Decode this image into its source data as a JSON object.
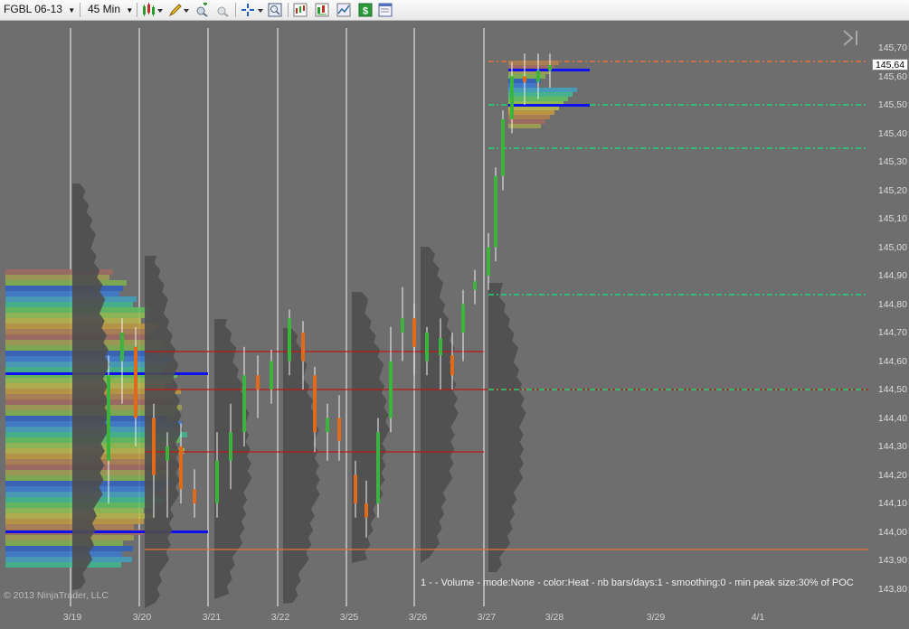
{
  "toolbar": {
    "instrument": "FGBL 06-13",
    "interval": "45 Min",
    "icons": [
      "bar-type-icon",
      "drawing-pencil-icon",
      "zoom-in-icon",
      "zoom-out-icon",
      "crosshair-icon",
      "data-box-icon",
      "indicators-icon",
      "strategies-icon",
      "chart-trader-icon",
      "dollar-icon",
      "properties-icon"
    ]
  },
  "chart": {
    "current_price": "145,64",
    "price_axis": [
      "145,70",
      "145,60",
      "145,50",
      "145,40",
      "145,30",
      "145,20",
      "145,10",
      "145,00",
      "144,90",
      "144,80",
      "144,70",
      "144,60",
      "144,50",
      "144,40",
      "144,30",
      "144,20",
      "144,10",
      "144,00",
      "143,90",
      "143,80"
    ],
    "date_axis": [
      "3/19",
      "3/20",
      "3/21",
      "3/22",
      "3/25",
      "3/26",
      "3/27",
      "3/28",
      "3/29",
      "4/1"
    ],
    "legend": "1 -   - Volume - mode:None - color:Heat - nb bars/days:1 - smoothing:0 - min peak size:30% of POC",
    "copyright": "© 2013 NinjaTrader, LLC",
    "colors": {
      "background": "#6e6e6e",
      "up": "#3cb33c",
      "down": "#e06a1a",
      "poc": "#1010ee",
      "level_red": "#c01818",
      "level_green": "#1fd87a",
      "level_orange": "#e8703a"
    }
  }
}
